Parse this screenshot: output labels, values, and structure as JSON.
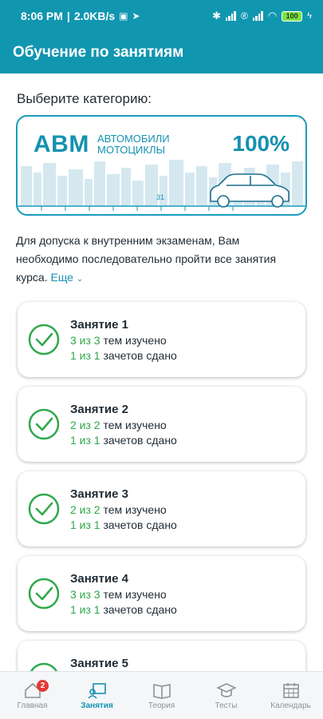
{
  "status_bar": {
    "time": "8:06 PM",
    "net_speed": "2.0KB/s",
    "battery": "100"
  },
  "app_bar": {
    "title": "Обучение по занятиям"
  },
  "category": {
    "section_title": "Выберите категорию:",
    "code": "ABM",
    "desc_line1": "автомобили",
    "desc_line2": "мотоциклы",
    "percent": "100%",
    "km_marker": "31"
  },
  "info": {
    "text": "Для допуска к внутренним экзаменам, Вам необходимо последовательно пройти все занятия курса.",
    "more_label": "Еще"
  },
  "lessons": [
    {
      "title": "Занятие 1",
      "topics_count": "3 из 3",
      "topics_suffix": "тем изучено",
      "tests_count": "1 из 1",
      "tests_suffix": "зачетов сдано"
    },
    {
      "title": "Занятие 2",
      "topics_count": "2 из 2",
      "topics_suffix": "тем изучено",
      "tests_count": "1 из 1",
      "tests_suffix": "зачетов сдано"
    },
    {
      "title": "Занятие 3",
      "topics_count": "2 из 2",
      "topics_suffix": "тем изучено",
      "tests_count": "1 из 1",
      "tests_suffix": "зачетов сдано"
    },
    {
      "title": "Занятие 4",
      "topics_count": "3 из 3",
      "topics_suffix": "тем изучено",
      "tests_count": "1 из 1",
      "tests_suffix": "зачетов сдано"
    },
    {
      "title": "Занятие 5",
      "topics_count": "",
      "topics_suffix": "",
      "tests_count": "",
      "tests_suffix": ""
    }
  ],
  "nav": {
    "home": "Главная",
    "home_badge": "2",
    "lessons": "Занятия",
    "theory": "Теория",
    "tests": "Тесты",
    "calendar": "Календарь"
  },
  "colors": {
    "primary": "#1196b0",
    "accent_text": "#1591b0",
    "success": "#2ea84a",
    "badge": "#e53935"
  }
}
